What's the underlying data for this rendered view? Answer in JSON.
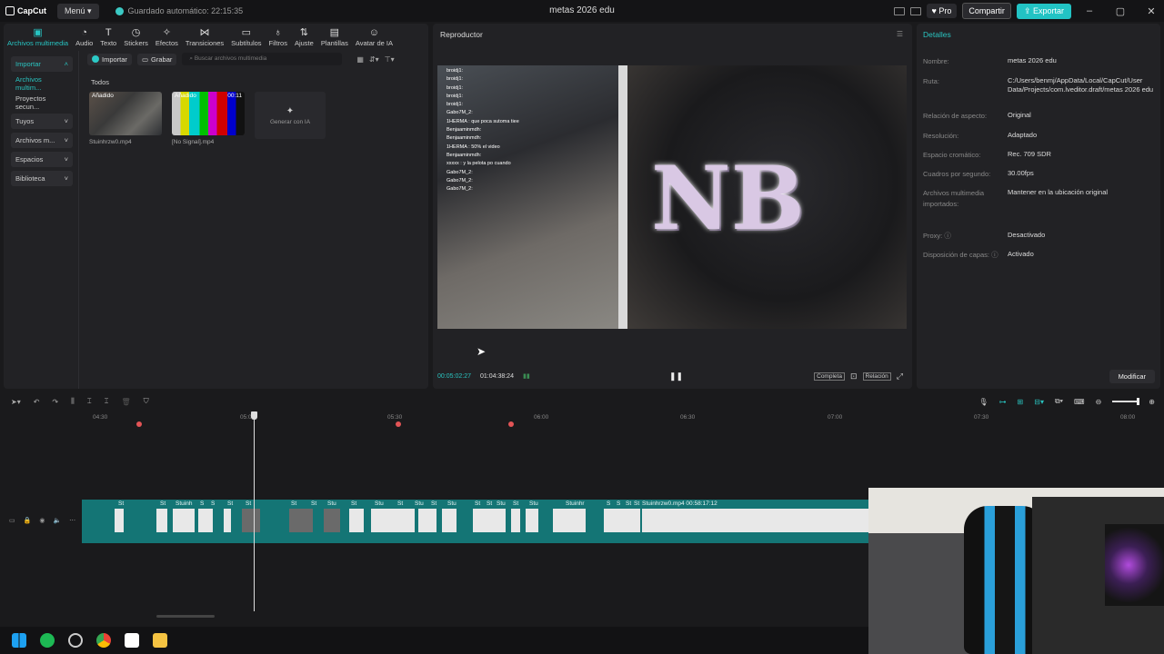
{
  "titlebar": {
    "app_name": "CapCut",
    "menu": "Menú",
    "autosave": "Guardado automático: 22:15:35",
    "project_title": "metas 2026 edu",
    "pro": "Pro",
    "share": "Compartir",
    "export": "Exportar"
  },
  "tools": [
    {
      "label": "Archivos multimedia",
      "icon": "media-icon"
    },
    {
      "label": "Audio",
      "icon": "audio-icon"
    },
    {
      "label": "Texto",
      "icon": "text-icon"
    },
    {
      "label": "Stickers",
      "icon": "sticker-icon"
    },
    {
      "label": "Efectos",
      "icon": "effects-icon"
    },
    {
      "label": "Transiciones",
      "icon": "transitions-icon"
    },
    {
      "label": "Subtítulos",
      "icon": "subtitles-icon"
    },
    {
      "label": "Filtros",
      "icon": "filters-icon"
    },
    {
      "label": "Ajuste",
      "icon": "adjust-icon"
    },
    {
      "label": "Plantillas",
      "icon": "templates-icon"
    },
    {
      "label": "Avatar de IA",
      "icon": "ai-avatar-icon"
    }
  ],
  "sidebar": {
    "items": [
      {
        "label": "Importar"
      },
      {
        "label": "Archivos multim..."
      },
      {
        "label": "Proyectos secun..."
      },
      {
        "label": "Tuyos"
      },
      {
        "label": "Archivos m..."
      },
      {
        "label": "Espacios"
      },
      {
        "label": "Biblioteca"
      }
    ]
  },
  "media": {
    "import_btn": "Importar",
    "record_btn": "Grabar",
    "search_placeholder": "Buscar archivos multimedia",
    "section": "Todos",
    "clips": [
      {
        "tag": "Añadido",
        "duration": "",
        "name": "Stuinhrzw0.mp4"
      },
      {
        "tag": "Añadido",
        "duration": "00:11",
        "name": "[No Signal].mp4"
      }
    ],
    "generate_ai": "Generar con IA"
  },
  "player": {
    "title": "Reproductor",
    "current_time": "00:05:02:27",
    "total_time": "01:04:38:24",
    "full_btn": "Completa",
    "ratio_btn": "Relación"
  },
  "details": {
    "title": "Detalles",
    "rows": [
      {
        "k": "Nombre:",
        "v": "metas 2026 edu"
      },
      {
        "k": "Ruta:",
        "v": "C:/Users/benmj/AppData/Local/CapCut/User Data/Projects/com.lveditor.draft/metas 2026 edu"
      },
      {
        "k": "Relación de aspecto:",
        "v": "Original"
      },
      {
        "k": "Resolución:",
        "v": "Adaptado"
      },
      {
        "k": "Espacio cromático:",
        "v": "Rec. 709 SDR"
      },
      {
        "k": "Cuadros por segundo:",
        "v": "30.00fps"
      },
      {
        "k": "Archivos multimedia importados:",
        "v": "Mantener en la ubicación original"
      },
      {
        "k": "Proxy:",
        "v": "Desactivado"
      },
      {
        "k": "Disposición de capas:",
        "v": "Activado"
      }
    ],
    "modify_btn": "Modificar"
  },
  "timeline": {
    "ruler": [
      "04:30",
      "05:00",
      "05:30",
      "06:00",
      "06:30",
      "07:00",
      "07:30",
      "08:00"
    ],
    "clip_labels": [
      "St",
      "St",
      "Stuinh",
      "S",
      "S",
      "St",
      "St",
      "St",
      "St",
      "Stu",
      "St",
      "Stu",
      "St",
      "Stu",
      "St",
      "Stu",
      "St",
      "St",
      "Stu",
      "St",
      "Stu",
      "Stuinhr",
      "S",
      "S",
      "St",
      "St"
    ],
    "main_clip": "Stuinhrzw0.mp4",
    "main_clip_duration": "00:58:17:12"
  },
  "chat_overlay": [
    "broidj1: ",
    "broidj1: ",
    "broidj1: ",
    "broidj1: ",
    "broidj1: ",
    "Gabo7M_2: ",
    "1HERMA : que poca sutoma tiee",
    "Benjaaminmdh: ",
    "Benjaaminmdh: ",
    "1HERMA : 50% el video",
    "Benjaaminmdh: ",
    "xxxxx : y la pelota po cuando",
    "Gabo7M_2: ",
    "Gabo7M_2: ",
    "Gabo7M_2: "
  ],
  "colors": {
    "accent": "#22c3c4",
    "track": "#147575",
    "marker": "#e35456"
  }
}
